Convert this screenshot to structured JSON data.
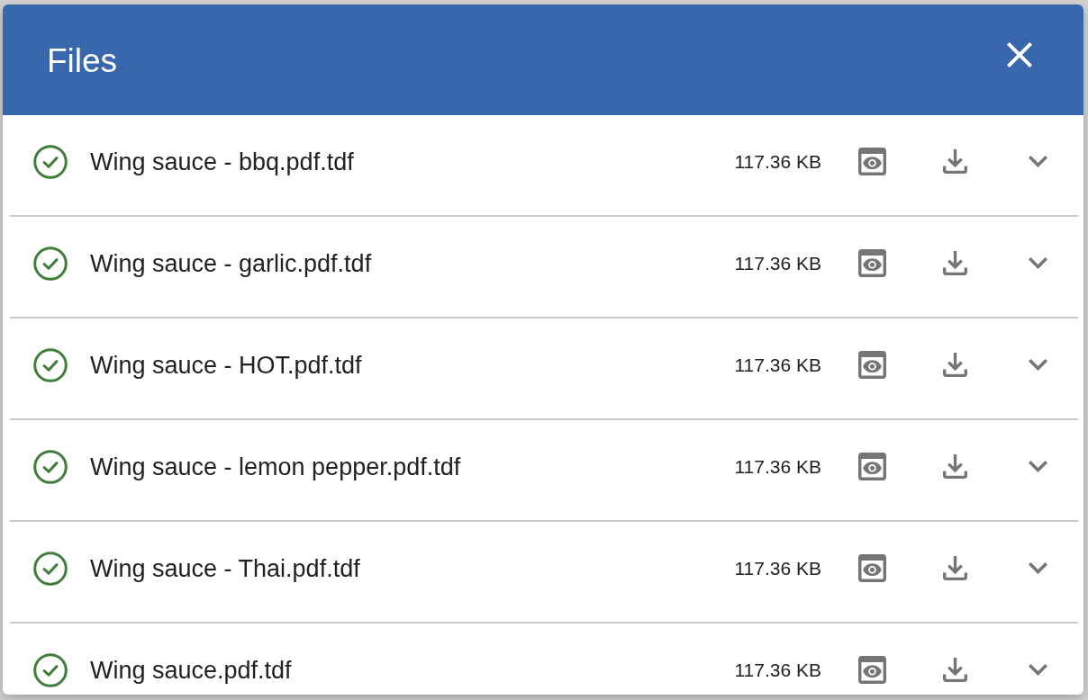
{
  "dialog": {
    "title": "Files"
  },
  "files": [
    {
      "name": "Wing sauce - bbq.pdf.tdf",
      "size": "117.36 KB"
    },
    {
      "name": "Wing sauce - garlic.pdf.tdf",
      "size": "117.36 KB"
    },
    {
      "name": "Wing sauce - HOT.pdf.tdf",
      "size": "117.36 KB"
    },
    {
      "name": "Wing sauce - lemon pepper.pdf.tdf",
      "size": "117.36 KB"
    },
    {
      "name": "Wing sauce - Thai.pdf.tdf",
      "size": "117.36 KB"
    },
    {
      "name": "Wing sauce.pdf.tdf",
      "size": "117.36 KB"
    }
  ]
}
